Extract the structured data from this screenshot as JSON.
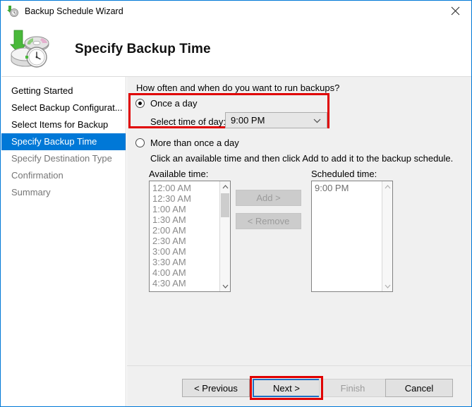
{
  "window": {
    "title": "Backup Schedule Wizard",
    "title_icon": "backup-clock-icon",
    "close_icon": "close-icon"
  },
  "header": {
    "title": "Specify Backup Time",
    "icon": "backup-disc-clock-icon"
  },
  "sidebar": {
    "items": [
      {
        "label": "Getting Started",
        "state": "done"
      },
      {
        "label": "Select Backup Configurat...",
        "state": "done"
      },
      {
        "label": "Select Items for Backup",
        "state": "done"
      },
      {
        "label": "Specify Backup Time",
        "state": "active"
      },
      {
        "label": "Specify Destination Type",
        "state": "future"
      },
      {
        "label": "Confirmation",
        "state": "future"
      },
      {
        "label": "Summary",
        "state": "future"
      }
    ]
  },
  "main": {
    "question": "How often and when do you want to run backups?",
    "once_a_day": {
      "label": "Once a day",
      "selected": true,
      "time_label": "Select time of day:",
      "time_value": "9:00 PM",
      "chevron_icon": "chevron-down-icon"
    },
    "more_than_once": {
      "label": "More than once a day",
      "selected": false,
      "hint": "Click an available time and then click Add to add it to the backup schedule."
    },
    "available": {
      "label": "Available time:",
      "items": [
        "12:00 AM",
        "12:30 AM",
        "1:00 AM",
        "1:30 AM",
        "2:00 AM",
        "2:30 AM",
        "3:00 AM",
        "3:30 AM",
        "4:00 AM",
        "4:30 AM"
      ]
    },
    "scheduled": {
      "label": "Scheduled time:",
      "items": [
        "9:00 PM"
      ]
    },
    "add_label": "Add >",
    "remove_label": "< Remove"
  },
  "footer": {
    "previous": "< Previous",
    "next": "Next >",
    "finish": "Finish",
    "cancel": "Cancel"
  },
  "annotations": {
    "highlight_color": "#e00000",
    "focus_color": "#1a6fc4",
    "accent_color": "#0078d7"
  }
}
